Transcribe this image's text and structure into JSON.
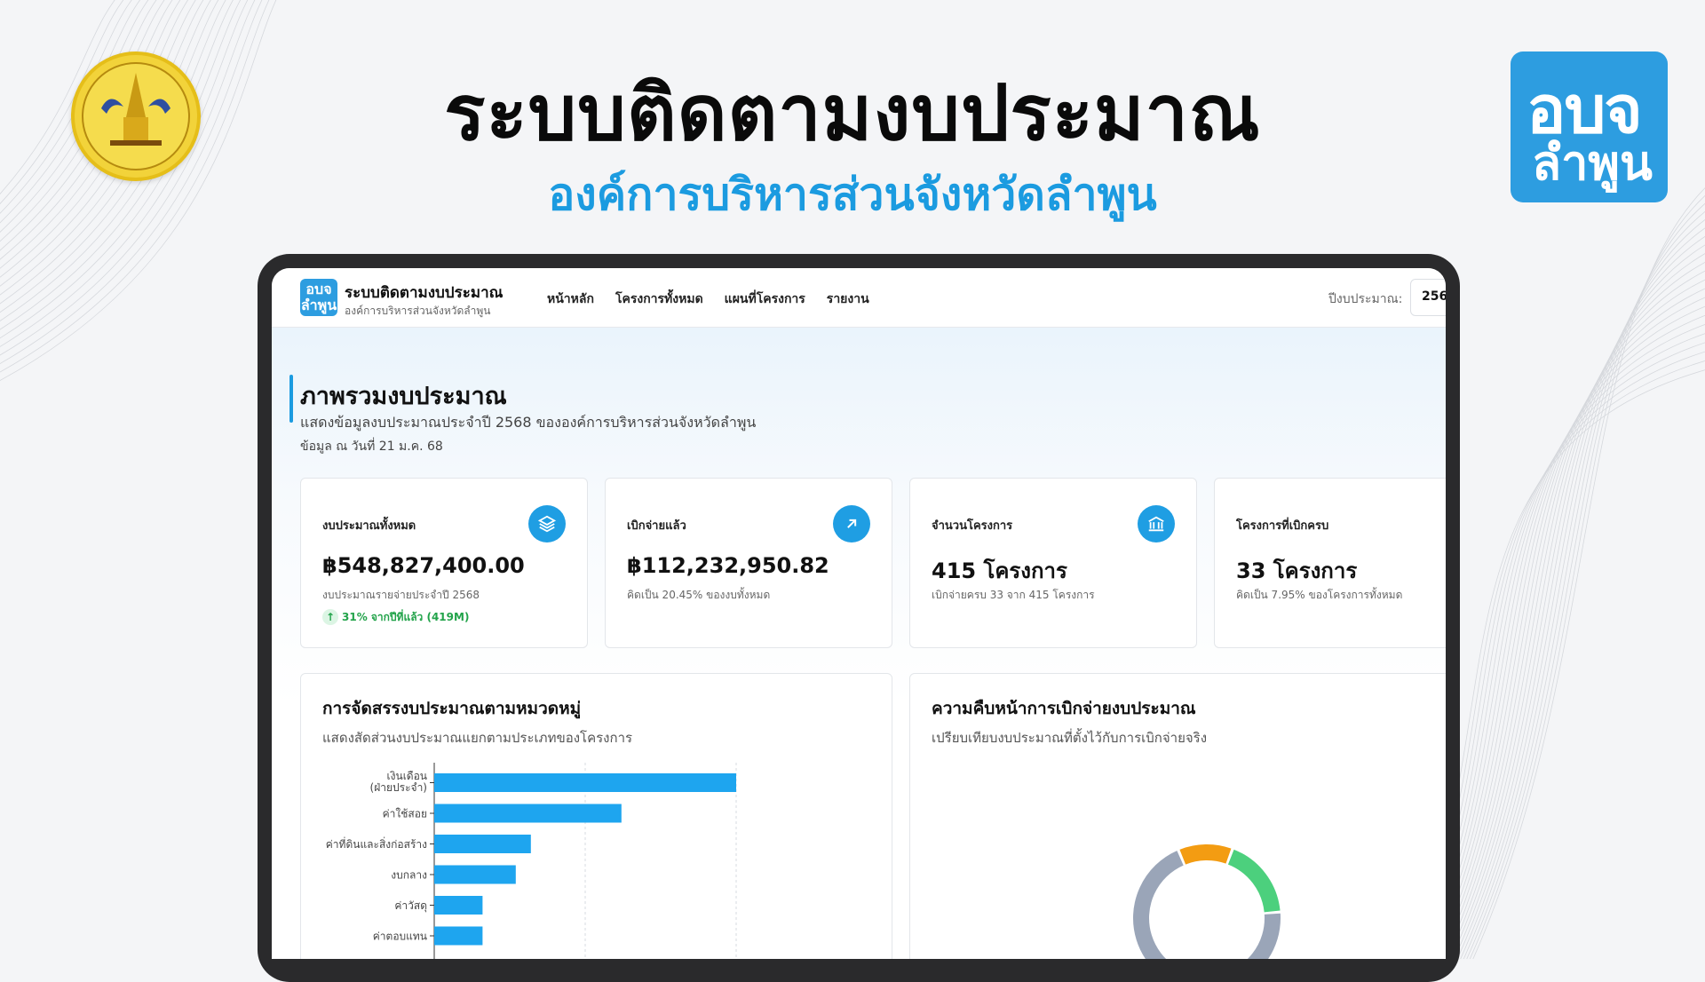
{
  "header": {
    "title": "ระบบติดตามงบประมาณ",
    "subtitle": "องค์การบริหารส่วนจังหวัดลำพูน",
    "logo_right_line1": "อบจ",
    "logo_right_line2": "ลำพูน"
  },
  "navbar": {
    "logo_text": "อบจ ลำพูน",
    "title": "ระบบติดตามงบประมาณ",
    "subtitle": "องค์การบริหารส่วนจังหวัดลำพูน",
    "links": [
      "หน้าหลัก",
      "โครงการทั้งหมด",
      "แผนที่โครงการ",
      "รายงาน"
    ],
    "year_label": "ปีงบประมาณ:",
    "year_value": "256"
  },
  "overview": {
    "title": "ภาพรวมงบประมาณ",
    "description": "แสดงข้อมูลงบประมาณประจำปี 2568 ขององค์การบริหารส่วนจังหวัดลำพูน",
    "date": "ข้อมูล ณ วันที่ 21 ม.ค. 68"
  },
  "cards": [
    {
      "label": "งบประมาณทั้งหมด",
      "value": "฿548,827,400.00",
      "note": "งบประมาณรายจ่ายประจำปี 2568",
      "trend": "31% จากปีที่แล้ว (419M)",
      "icon": "layers-icon"
    },
    {
      "label": "เบิกจ่ายแล้ว",
      "value": "฿112,232,950.82",
      "note": "คิดเป็น 20.45% ของงบทั้งหมด",
      "icon": "arrow-up-right-icon"
    },
    {
      "label": "จำนวนโครงการ",
      "value": "415 โครงการ",
      "note": "เบิกจ่ายครบ 33 จาก 415 โครงการ",
      "icon": "bank-icon"
    },
    {
      "label": "โครงการที่เบิกครบ",
      "value": "33 โครงการ",
      "note": "คิดเป็น 7.95% ของโครงการทั้งหมด"
    }
  ],
  "allocation_panel": {
    "title": "การจัดสรรงบประมาณตามหมวดหมู่",
    "description": "แสดงสัดส่วนงบประมาณแยกตามประเภทของโครงการ"
  },
  "progress_panel": {
    "title": "ความคืบหน้าการเบิกจ่ายงบประมาณ",
    "description": "เปรียบเทียบงบประมาณที่ตั้งไว้กับการเบิกจ่ายจริง"
  },
  "colors": {
    "accent": "#1b9be0",
    "bar": "#1ea5ef",
    "donut_green": "#4cd07d",
    "donut_orange": "#f39c12",
    "donut_gray": "#9aa5b8"
  },
  "chart_data": [
    {
      "type": "bar",
      "orientation": "horizontal",
      "categories": [
        "เงินเดือน (ฝ่ายประจำ)",
        "ค่าใช้สอย",
        "ค่าที่ดินและสิ่งก่อสร้าง",
        "งบกลาง",
        "ค่าวัสดุ",
        "ค่าตอบแทน"
      ],
      "values": [
        100,
        62,
        32,
        27,
        16,
        16
      ],
      "grid": true
    },
    {
      "type": "pie",
      "donut": true,
      "values": [
        70,
        12,
        18
      ],
      "colors": [
        "#9aa5b8",
        "#f39c12",
        "#4cd07d"
      ]
    }
  ]
}
